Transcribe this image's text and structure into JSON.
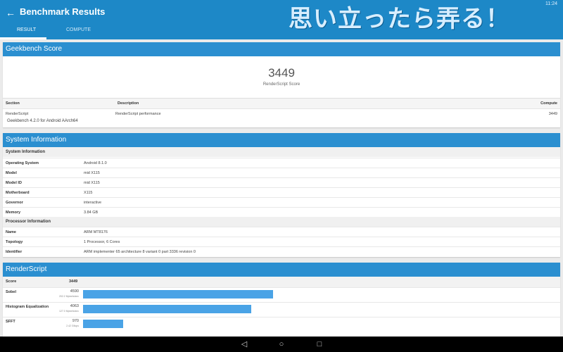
{
  "appbar": {
    "title": "Benchmark Results",
    "back_icon": "arrow-left-icon",
    "status_time": "11:24",
    "watermark": "思い立ったら弄る！",
    "tabs": [
      {
        "label": "RESULT",
        "active": true
      },
      {
        "label": "COMPUTE",
        "active": false
      }
    ]
  },
  "geekbench": {
    "header": "Geekbench Score",
    "score": "3449",
    "score_label": "RenderScript Score",
    "table": {
      "headers": [
        "Section",
        "Description",
        "Compute"
      ],
      "rows": [
        [
          "RenderScript",
          "RenderScript performance",
          "3449"
        ]
      ]
    },
    "version": "Geekbench 4.2.0 for Android AArch64"
  },
  "system": {
    "header": "System Information",
    "sections": [
      {
        "title": "System Information",
        "rows": [
          {
            "k": "Operating System",
            "v": "Android 8.1.0"
          },
          {
            "k": "Model",
            "v": "mid X115"
          },
          {
            "k": "Model ID",
            "v": "mid X115"
          },
          {
            "k": "Motherboard",
            "v": "X115"
          },
          {
            "k": "Governor",
            "v": "interactive"
          },
          {
            "k": "Memory",
            "v": "3.84 GB"
          }
        ]
      },
      {
        "title": "Processor Information",
        "rows": [
          {
            "k": "Name",
            "v": "ARM MT8176"
          },
          {
            "k": "Topology",
            "v": "1 Processor, 6 Cores"
          },
          {
            "k": "Identifier",
            "v": "ARM implementer 65 architecture 8 variant 0 part 3336 revision 0"
          }
        ]
      }
    ]
  },
  "renderscript": {
    "header": "RenderScript",
    "score_label": "Score",
    "score": "3449",
    "bars": [
      {
        "name": "Sobel",
        "value": 4590,
        "sub": "202.2 Mpixels/sec"
      },
      {
        "name": "Histogram Equalization",
        "value": 4063,
        "sub": "127.0 Mpixels/sec"
      },
      {
        "name": "SFFT",
        "value": 970,
        "sub": "2.42 Gflops"
      }
    ],
    "max_value": 4590
  },
  "colors": {
    "appbar": "#1d88c7",
    "card_header": "#2b8fd0",
    "bar": "#4aa3e6"
  },
  "nav": {
    "back_icon": "triangle-back-icon",
    "home_icon": "circle-home-icon",
    "recents_icon": "square-recents-icon"
  }
}
